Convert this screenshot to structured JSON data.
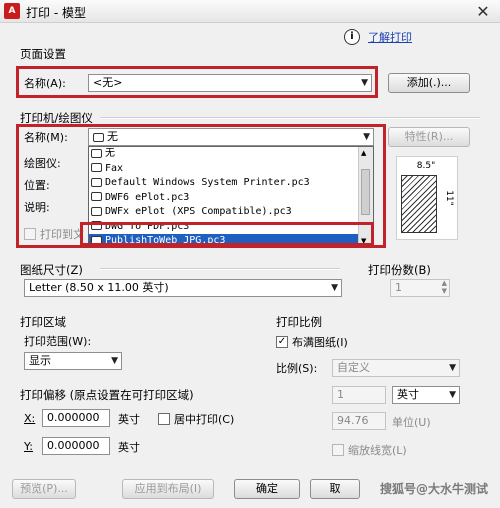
{
  "window": {
    "title": "打印 - 模型",
    "app_icon_text": "A"
  },
  "help": {
    "learn_link": "了解打印",
    "info_icon": "i"
  },
  "page_setup": {
    "section_label": "页面设置",
    "name_label": "名称(A):",
    "name_value": "<无>",
    "add_button": "添加(.)..."
  },
  "printer": {
    "section_label": "打印机/绘图仪",
    "name_label": "名称(M):",
    "name_value": "无",
    "properties_button": "特性(R)...",
    "plotter_label": "绘图仪:",
    "location_label": "位置:",
    "description_label": "说明:",
    "print_to_file_label": "打印到文",
    "dropdown_items": [
      "无",
      "Fax",
      "Default Windows System Printer.pc3",
      "DWF6 ePlot.pc3",
      "DWFx ePlot (XPS Compatible).pc3",
      "DWG To PDF.pc3",
      "PublishToWeb JPG.pc3"
    ],
    "selected_index": 6,
    "preview_dim": "8.5\"",
    "preview_dim_v": "11\""
  },
  "paper_size": {
    "label": "图纸尺寸(Z)",
    "value": "Letter (8.50 x 11.00 英寸)"
  },
  "copies": {
    "label": "打印份数(B)",
    "value": "1"
  },
  "plot_area": {
    "section_label": "打印区域",
    "what_label": "打印范围(W):",
    "what_value": "显示"
  },
  "plot_scale": {
    "section_label": "打印比例",
    "fit_label": "布满图纸(I)",
    "fit_checked": true,
    "scale_label": "比例(S):",
    "scale_value": "自定义",
    "value1": "1",
    "unit_value": "英寸",
    "value2": "94.76",
    "unit_label": "单位(U)",
    "lineweights_label": "缩放线宽(L)"
  },
  "plot_offset": {
    "section_label": "打印偏移 (原点设置在可打印区域)",
    "x_label": "X:",
    "x_value": "0.000000",
    "x_unit": "英寸",
    "center_label": "居中打印(C)",
    "y_label": "Y:",
    "y_value": "0.000000",
    "y_unit": "英寸"
  },
  "footer": {
    "preview_button": "预览(P)...",
    "apply_button": "应用到布局(I)",
    "ok_button": "确定",
    "cancel_button": "取",
    "watermark": "搜狐号@大水牛测试"
  },
  "colors": {
    "highlight_red": "#c0232a",
    "selection_blue": "#1f5fbf",
    "link": "#1a3fb3"
  }
}
